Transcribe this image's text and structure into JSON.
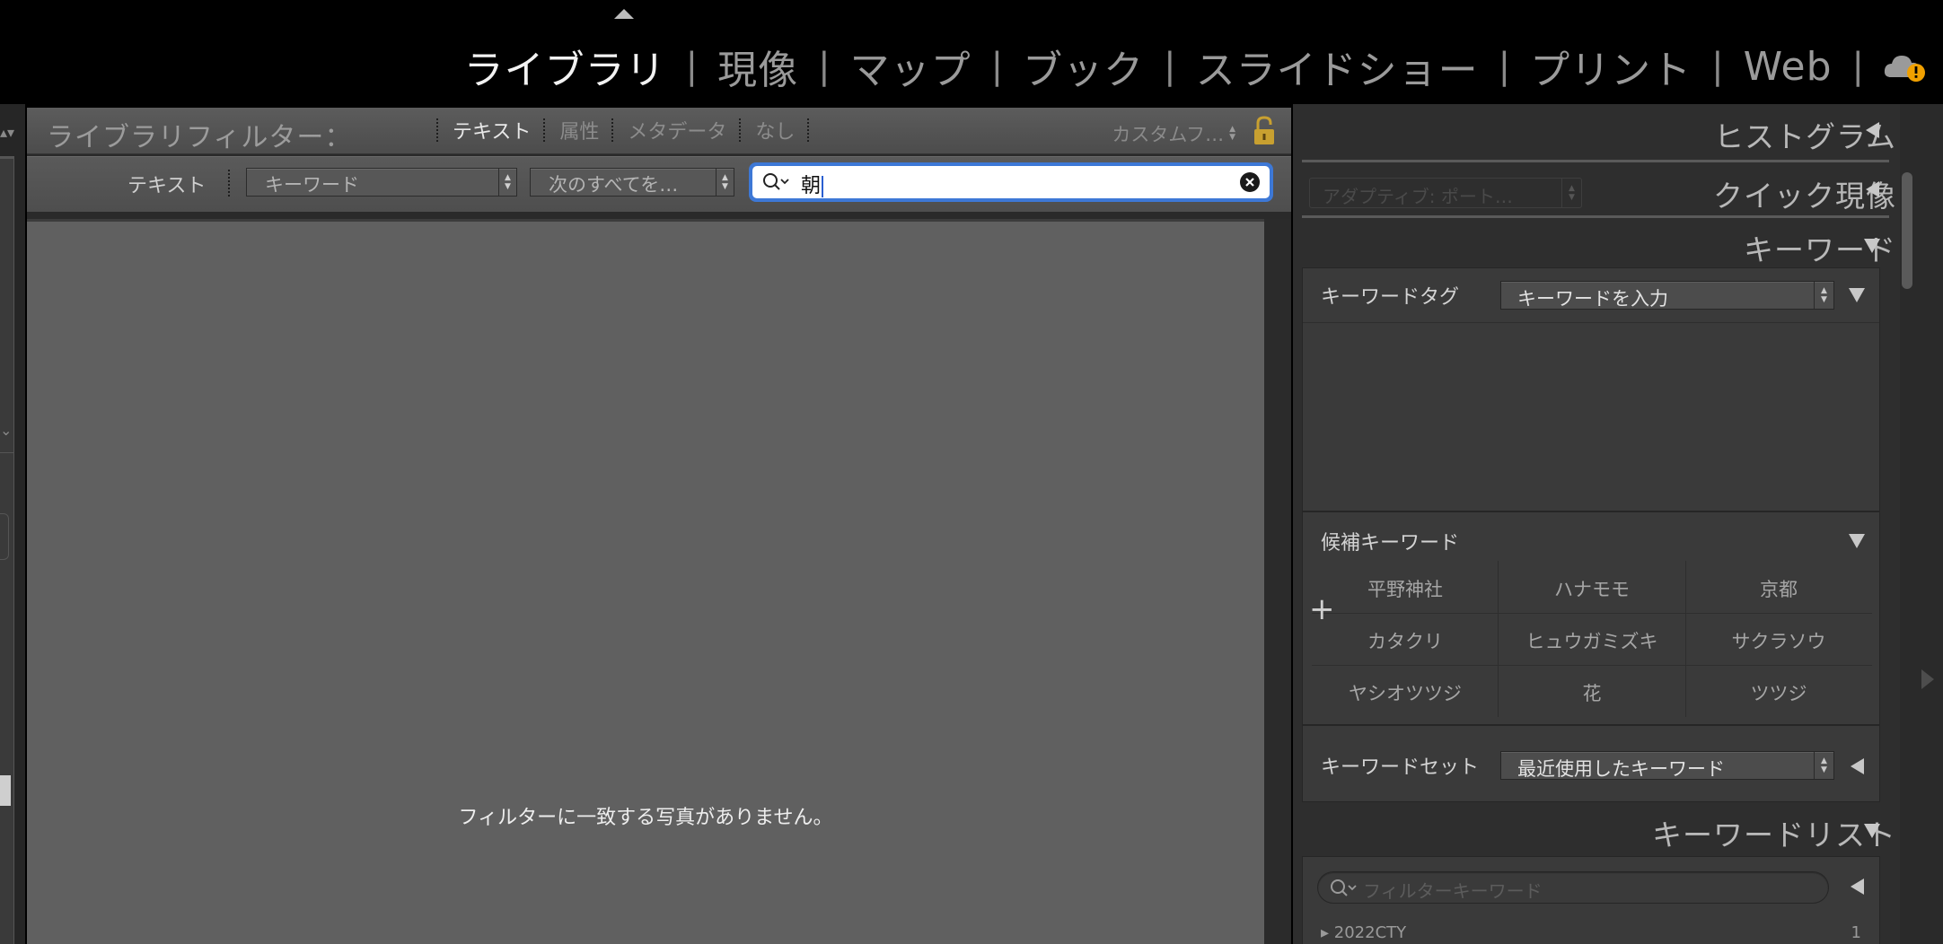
{
  "modules": {
    "items": [
      {
        "label": "ライブラリ",
        "active": true
      },
      {
        "label": "現像"
      },
      {
        "label": "マップ"
      },
      {
        "label": "ブック"
      },
      {
        "label": "スライドショー"
      },
      {
        "label": "プリント"
      },
      {
        "label": "Web"
      }
    ],
    "separator": "|",
    "cloud_status": "warning"
  },
  "library_filter": {
    "title": "ライブラリフィルター：",
    "tabs": [
      {
        "label": "テキスト",
        "active": true
      },
      {
        "label": "属性"
      },
      {
        "label": "メタデータ"
      },
      {
        "label": "なし"
      }
    ],
    "custom_preset": "カスタムフ…",
    "lock_state": "unlocked"
  },
  "text_filter": {
    "label": "テキスト",
    "field_select": "キーワード",
    "rule_select": "次のすべてを…",
    "search_value": "朝"
  },
  "grid": {
    "empty_message": "フィルターに一致する写真がありません。"
  },
  "right_panel": {
    "histogram_title": "ヒストグラム",
    "quick_develop_title": "クイック現像",
    "quick_develop_preset": "アダプティブ: ポート…",
    "keywording_title": "キーワード",
    "keyword_tags_label": "キーワードタグ",
    "keyword_tags_select": "キーワードを入力",
    "suggestions_label": "候補キーワード",
    "suggestions": [
      "平野神社",
      "ハナモモ",
      "京都",
      "カタクリ",
      "ヒュウガミズキ",
      "サクラソウ",
      "ヤシオツツジ",
      "花",
      "ツツジ"
    ],
    "keyword_set_label": "キーワードセット",
    "keyword_set_select": "最近使用したキーワード",
    "keyword_list_title": "キーワードリスト",
    "keyword_filter_placeholder": "フィルターキーワード",
    "keyword_list_first": "2022CTY",
    "keyword_list_first_count": "1"
  },
  "colors": {
    "search_focus": "#3d78d6",
    "cloud_badge": "#f0a000",
    "lock_gold": "#c8a030"
  }
}
